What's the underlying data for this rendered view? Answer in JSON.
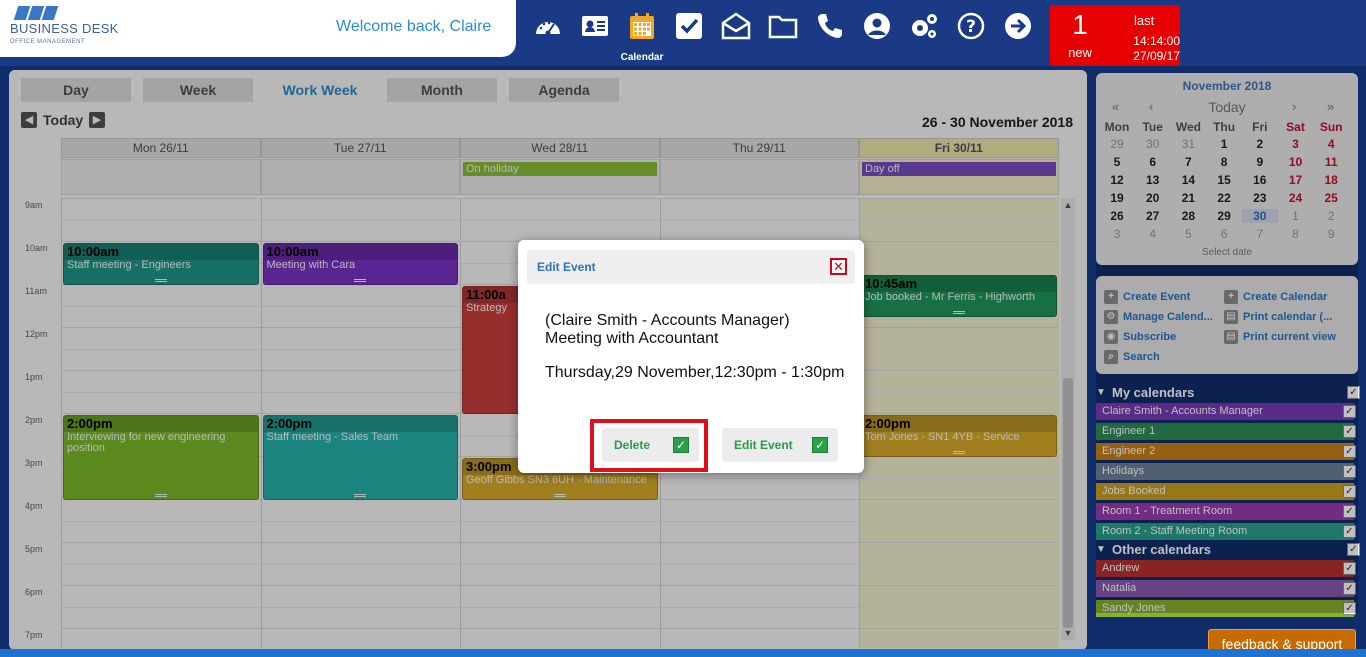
{
  "brand": {
    "name": "BUSINESS DESK",
    "sub": "OFFICE MANAGEMENT"
  },
  "header": {
    "welcome": "Welcome back, Claire",
    "active_nav_label": "Calendar",
    "nav_icons": [
      "dashboard-icon",
      "contacts-card-icon",
      "calendar-icon",
      "tasks-check-icon",
      "mail-icon",
      "folder-icon",
      "phone-icon",
      "user-profile-icon",
      "settings-gears-icon",
      "help-icon",
      "logout-arrow-icon"
    ]
  },
  "notification": {
    "count": "1",
    "new_label": "new",
    "last_label": "last",
    "time": "14:14:00",
    "date": "27/09/17"
  },
  "views": {
    "tabs": [
      "Day",
      "Week",
      "Work Week",
      "Month",
      "Agenda"
    ],
    "active": "Work Week",
    "today_label": "Today",
    "range": "26 - 30 November 2018"
  },
  "days": [
    "Mon 26/11",
    "Tue 27/11",
    "Wed 28/11",
    "Thu 29/11",
    "Fri 30/11"
  ],
  "allday_events": [
    {
      "day": 2,
      "title": "On holiday",
      "color": "#8fc23b"
    },
    {
      "day": 4,
      "title": "Day off",
      "color": "#7b4fc7"
    }
  ],
  "hours": [
    "9am",
    "10am",
    "11am",
    "12pm",
    "1pm",
    "2pm",
    "3pm",
    "4pm",
    "5pm",
    "6pm",
    "7pm"
  ],
  "events": [
    {
      "day": 0,
      "start": 10,
      "end": 11,
      "time": "10:00am",
      "title": "Staff meeting - Engineers",
      "color": "#1f9b8c"
    },
    {
      "day": 1,
      "start": 10,
      "end": 11,
      "time": "10:00am",
      "title": "Meeting with Cara",
      "color": "#7b34c9"
    },
    {
      "day": 2,
      "start": 11,
      "end": 14,
      "time": "11:00a",
      "title": "Strategy",
      "color": "#d24040"
    },
    {
      "day": 4,
      "start": 10.75,
      "end": 11.75,
      "time": "10:45am",
      "title": "Job booked - Mr Ferris - Highworth",
      "color": "#1f9b5e"
    },
    {
      "day": 0,
      "start": 14,
      "end": 16,
      "time": "2:00pm",
      "title": "Interviewing for new engineering position",
      "color": "#7fbf2a"
    },
    {
      "day": 1,
      "start": 14,
      "end": 16,
      "time": "2:00pm",
      "title": "Staff meeting - Sales Team",
      "color": "#28b8b0"
    },
    {
      "day": 2,
      "start": 15,
      "end": 16,
      "time": "3:00pm",
      "title": "Geoff Gibbs SN3 6UH - Maintenance",
      "color": "#e0b12a"
    },
    {
      "day": 4,
      "start": 14,
      "end": 15,
      "time": "2:00pm",
      "title": "Tom Jones - SN1 4YB - Service",
      "color": "#e0b12a"
    }
  ],
  "mini_calendar": {
    "title": "November 2018",
    "today_label": "Today",
    "nav": [
      "«",
      "‹",
      "›",
      "»"
    ],
    "weekdays": [
      "Mon",
      "Tue",
      "Wed",
      "Thu",
      "Fri",
      "Sat",
      "Sun"
    ],
    "weeks": [
      [
        "29",
        "30",
        "31",
        "1",
        "2",
        "3",
        "4"
      ],
      [
        "5",
        "6",
        "7",
        "8",
        "9",
        "10",
        "11"
      ],
      [
        "12",
        "13",
        "14",
        "15",
        "16",
        "17",
        "18"
      ],
      [
        "19",
        "20",
        "21",
        "22",
        "23",
        "24",
        "25"
      ],
      [
        "26",
        "27",
        "28",
        "29",
        "30",
        "1",
        "2"
      ],
      [
        "3",
        "4",
        "5",
        "6",
        "7",
        "8",
        "9"
      ]
    ],
    "selected": "30",
    "footer": "Select date"
  },
  "actions": [
    {
      "label": "Create Event",
      "icon": "create-event-icon"
    },
    {
      "label": "Create Calendar",
      "icon": "create-calendar-icon"
    },
    {
      "label": "Manage Calend...",
      "icon": "manage-calendar-icon"
    },
    {
      "label": "Print calendar (...",
      "icon": "print-calendar-icon"
    },
    {
      "label": "Subscribe",
      "icon": "subscribe-icon"
    },
    {
      "label": "Print current view",
      "icon": "print-view-icon"
    },
    {
      "label": "Search",
      "icon": "search-icon"
    }
  ],
  "my_calendars": {
    "title": "My calendars",
    "items": [
      {
        "name": "Claire Smith - Accounts Manager",
        "color": "#7a3ab8"
      },
      {
        "name": "Engineer 1",
        "color": "#2e8b57"
      },
      {
        "name": "Engineer 2",
        "color": "#c9801a"
      },
      {
        "name": "Holidays",
        "color": "#6d7f98"
      },
      {
        "name": "Jobs Booked",
        "color": "#c8a020"
      },
      {
        "name": "Room 1 - Treatment Room",
        "color": "#9a3ab0"
      },
      {
        "name": "Room 2 - Staff Meeting Room",
        "color": "#2aa08a"
      }
    ]
  },
  "other_calendars": {
    "title": "Other calendars",
    "items": [
      {
        "name": "Andrew",
        "color": "#b83030"
      },
      {
        "name": "Natalia",
        "color": "#8a5ab0"
      },
      {
        "name": "Sandy Jones",
        "color": "#8ab030"
      }
    ]
  },
  "modal": {
    "title": "Edit Event",
    "line1": "(Claire Smith - Accounts Manager)",
    "line2": "Meeting with Accountant",
    "when": "Thursday,29 November,12:30pm - 1:30pm",
    "delete_label": "Delete",
    "edit_label": "Edit Event"
  },
  "feedback_label": "feedback & support"
}
